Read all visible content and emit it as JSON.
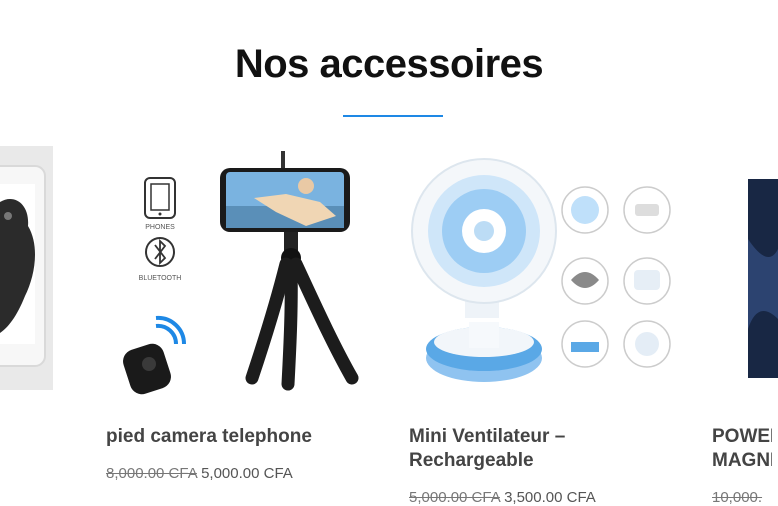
{
  "section": {
    "title": "Nos accessoires"
  },
  "products": [
    {
      "name": "pied camera telephone",
      "price_old": "8,000.00 CFA",
      "price_new": "5,000.00 CFA",
      "image_labels": {
        "phones": "PHONES",
        "bluetooth": "BLUETOOTH"
      }
    },
    {
      "name": "Mini Ventilateur – Rechargeable",
      "price_old": "5,000.00 CFA",
      "price_new": "3,500.00 CFA"
    },
    {
      "name": "POWER MAGNE",
      "price_old": "10,000.",
      "price_new": ""
    }
  ],
  "colors": {
    "accent": "#1e88e5",
    "title": "#111111"
  },
  "icons": [
    "phone-icon",
    "bluetooth-icon",
    "remote-shutter-icon",
    "tripod-icon",
    "fan-icon"
  ]
}
